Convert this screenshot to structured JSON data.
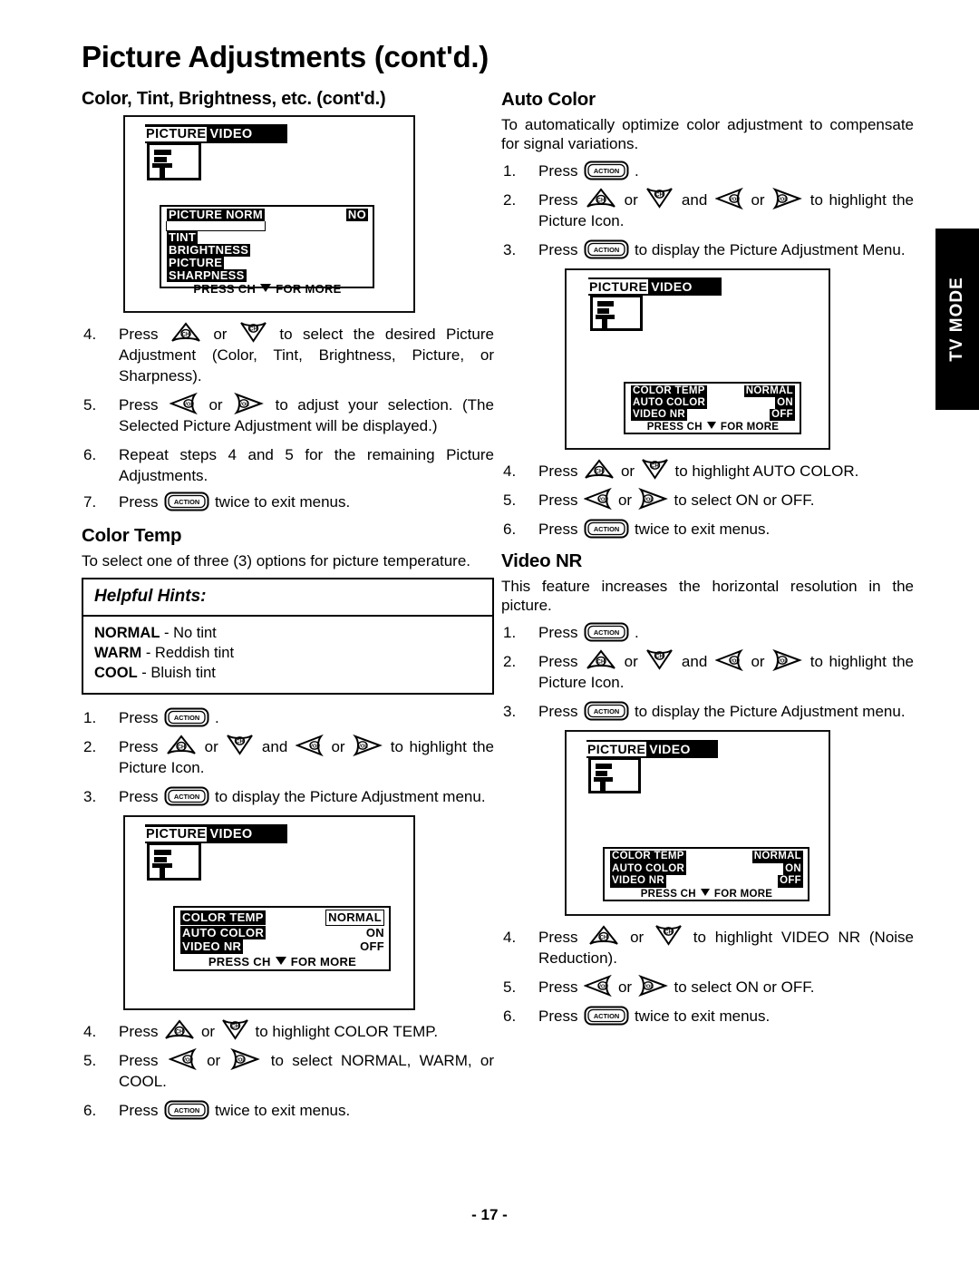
{
  "document": {
    "title": "Picture Adjustments (cont'd.)",
    "page_number": "- 17 -",
    "side_tab": "TV MODE"
  },
  "left_column": {
    "section1": {
      "heading": "Color, Tint, Brightness, etc. (cont'd.)",
      "osd": {
        "banner_highlight": "PICTURE",
        "banner_plain": "VIDEO",
        "rows": [
          {
            "label": "PICTURE NORM",
            "value": "NO"
          },
          {
            "label": "TINT",
            "value": ""
          },
          {
            "label": "BRIGHTNESS",
            "value": ""
          },
          {
            "label": "PICTURE",
            "value": ""
          },
          {
            "label": "SHARPNESS",
            "value": ""
          }
        ],
        "footer_left": "PRESS CH",
        "footer_right": "FOR MORE"
      },
      "steps": [
        {
          "num": "4.",
          "text_a": "Press",
          "key_a": "ch-up",
          "mid": "or",
          "key_b": "ch-down",
          "text_b": "to select the desired Picture Adjustment (Color, Tint, Brightness, Picture, or Sharpness)."
        },
        {
          "num": "5.",
          "text_a": "Press",
          "key_a": "vol-left",
          "mid": "or",
          "key_b": "vol-right",
          "text_b": "to adjust your selection. (The Selected Picture Adjustment will be displayed.)"
        },
        {
          "num": "6.",
          "text_a": "Repeat steps 4 and 5 for the remaining Picture Adjustments.",
          "key_a": "",
          "mid": "",
          "key_b": "",
          "text_b": ""
        },
        {
          "num": "7.",
          "text_a": "Press",
          "key_a": "action",
          "mid": "",
          "key_b": "",
          "text_b": "twice to exit menus."
        }
      ]
    },
    "section2": {
      "heading": "Color Temp",
      "intro": "To select one of three (3) options for picture temperature.",
      "hints": {
        "title": "Helpful Hints:",
        "lines": [
          {
            "term": "NORMAL",
            "desc": " - No tint"
          },
          {
            "term": "WARM",
            "desc": " - Reddish tint"
          },
          {
            "term": "COOL",
            "desc": " - Bluish tint"
          }
        ]
      },
      "steps_before": [
        {
          "num": "1.",
          "text_a": "Press",
          "key_a": "action",
          "text_b": "."
        },
        {
          "num": "2.",
          "text_a": "Press",
          "key_a": "ch-up",
          "mid": "or",
          "key_b": "ch-down",
          "mid2": "and",
          "key_c": "vol-left",
          "mid3": "or",
          "key_d": "vol-right",
          "text_b": "to highlight the Picture Icon."
        },
        {
          "num": "3.",
          "text_a": "Press",
          "key_a": "action",
          "text_b": "to display the Picture Adjustment menu."
        }
      ],
      "osd": {
        "banner_highlight": "PICTURE",
        "banner_plain": "VIDEO",
        "rows": [
          {
            "label": "COLOR TEMP",
            "value": "NORMAL"
          },
          {
            "label": "AUTO COLOR",
            "value": "ON"
          },
          {
            "label": "VIDEO NR",
            "value": "OFF"
          }
        ],
        "footer_left": "PRESS CH",
        "footer_right": "FOR MORE"
      },
      "steps_after": [
        {
          "num": "4.",
          "text_a": "Press",
          "key_a": "ch-up",
          "mid": "or",
          "key_b": "ch-down",
          "text_b": "to highlight COLOR TEMP."
        },
        {
          "num": "5.",
          "text_a": "Press",
          "key_a": "vol-left",
          "mid": "or",
          "key_b": "vol-right",
          "text_b": "to select NORMAL, WARM, or COOL."
        },
        {
          "num": "6.",
          "text_a": "Press",
          "key_a": "action",
          "text_b": "twice to exit menus."
        }
      ]
    }
  },
  "right_column": {
    "section1": {
      "heading": "Auto Color",
      "intro": "To automatically optimize color adjustment to compensate for signal variations.",
      "steps_before": [
        {
          "num": "1.",
          "text_a": "Press",
          "key_a": "action",
          "text_b": "."
        },
        {
          "num": "2.",
          "text_a": "Press",
          "key_a": "ch-up",
          "mid": "or",
          "key_b": "ch-down",
          "mid2": "and",
          "key_c": "vol-left",
          "mid3": "or",
          "key_d": "vol-right",
          "text_b": "to highlight the Picture Icon."
        },
        {
          "num": "3.",
          "text_a": "Press",
          "key_a": "action",
          "text_b": "to display the Picture Adjustment Menu."
        }
      ],
      "osd": {
        "banner_highlight": "PICTURE",
        "banner_plain": "VIDEO",
        "rows": [
          {
            "label": "COLOR TEMP",
            "value": "NORMAL"
          },
          {
            "label": "AUTO COLOR",
            "value": "ON"
          },
          {
            "label": "VIDEO NR",
            "value": "OFF"
          }
        ],
        "footer_left": "PRESS CH",
        "footer_right": "FOR MORE"
      },
      "steps_after": [
        {
          "num": "4.",
          "text_a": "Press",
          "key_a": "ch-up",
          "mid": "or",
          "key_b": "ch-down",
          "text_b": "to highlight AUTO COLOR."
        },
        {
          "num": "5.",
          "text_a": "Press",
          "key_a": "vol-left",
          "mid": "or",
          "key_b": "vol-right",
          "text_b": "to select ON or OFF."
        },
        {
          "num": "6.",
          "text_a": "Press",
          "key_a": "action",
          "text_b": "twice to exit menus."
        }
      ]
    },
    "section2": {
      "heading": "Video NR",
      "intro": "This feature increases the horizontal resolution in the picture.",
      "steps_before": [
        {
          "num": "1.",
          "text_a": "Press",
          "key_a": "action",
          "text_b": "."
        },
        {
          "num": "2.",
          "text_a": "Press",
          "key_a": "ch-up",
          "mid": "or",
          "key_b": "ch-down",
          "mid2": "and",
          "key_c": "vol-left",
          "mid3": "or",
          "key_d": "vol-right",
          "text_b": "to highlight the Picture Icon."
        },
        {
          "num": "3.",
          "text_a": "Press",
          "key_a": "action",
          "text_b": "to display the Picture Adjustment menu."
        }
      ],
      "osd": {
        "banner_highlight": "PICTURE",
        "banner_plain": "VIDEO",
        "rows": [
          {
            "label": "COLOR TEMP",
            "value": "NORMAL"
          },
          {
            "label": "AUTO COLOR",
            "value": "ON"
          },
          {
            "label": "VIDEO NR",
            "value": "OFF"
          }
        ],
        "footer_left": "PRESS CH",
        "footer_right": "FOR MORE"
      },
      "steps_after": [
        {
          "num": "4.",
          "text_a": "Press",
          "key_a": "ch-up",
          "mid": "or",
          "key_b": "ch-down",
          "text_b": "to highlight VIDEO NR (Noise Reduction)."
        },
        {
          "num": "5.",
          "text_a": "Press",
          "key_a": "vol-left",
          "mid": "or",
          "key_b": "vol-right",
          "text_b": "to select ON or OFF."
        },
        {
          "num": "6.",
          "text_a": "Press",
          "key_a": "action",
          "text_b": "twice to exit menus."
        }
      ]
    }
  },
  "key_labels": {
    "ch": "CH",
    "vol": "VOL",
    "action": "ACTION"
  }
}
